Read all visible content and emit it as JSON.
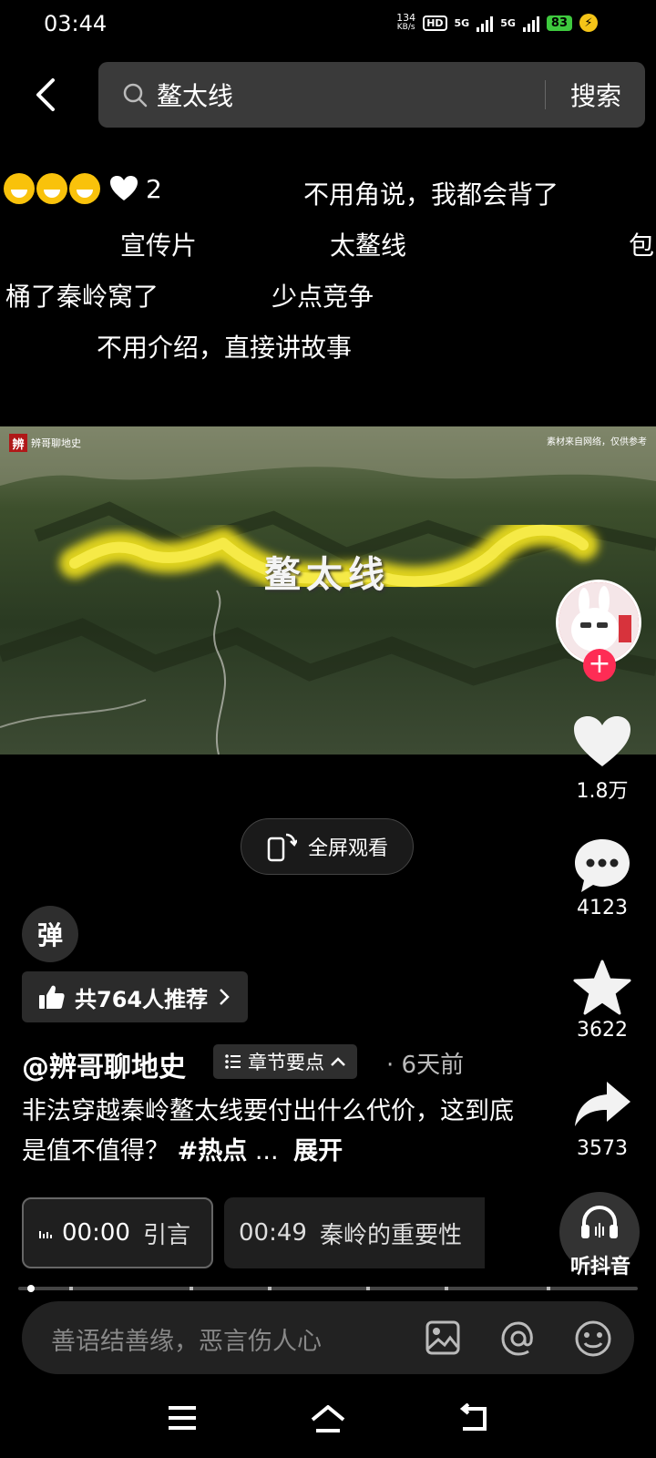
{
  "status_bar": {
    "time": "03:44",
    "net_speed": "134",
    "net_unit": "KB/s",
    "hd": "HD",
    "sim1": "5G",
    "sim2": "5G",
    "battery": "83"
  },
  "search": {
    "query": "鳌太线",
    "button_label": "搜索"
  },
  "danmaku": {
    "likes": "2",
    "lines": [
      "不用角说，我都会背了",
      "宣传片",
      "太鳌线",
      "包",
      "桶了秦岭窝了",
      "少点竞争",
      "不用介绍，直接讲故事"
    ]
  },
  "video": {
    "channel_logo_text": "辨哥聊地史",
    "watermark": "素材来自网络，仅供参考",
    "overlay_title": "鳌太线"
  },
  "actions": {
    "like_count": "1.8万",
    "comment_count": "4123",
    "favorite_count": "3622",
    "share_count": "3573",
    "listen_label": "听抖音"
  },
  "player": {
    "fullscreen_label": "全屏观看",
    "danmaku_toggle": "弹"
  },
  "recommend": {
    "label": "共764人推荐"
  },
  "post": {
    "author": "@辨哥聊地史",
    "chapter_tag": "章节要点",
    "time": "· 6天前",
    "caption_text": "非法穿越秦岭鳌太线要付出什么代价，这到底是值不值得？",
    "hashtag": "#热点",
    "ellipsis": "...",
    "expand_label": "展开"
  },
  "chapters": [
    {
      "time": "00:00",
      "title": "引言"
    },
    {
      "time": "00:49",
      "title": "秦岭的重要性"
    }
  ],
  "comment": {
    "placeholder": "善语结善缘，恶言伤人心"
  },
  "colors": {
    "accent": "#fe2c55",
    "highlight_route": "#f2e21c",
    "background": "#000000"
  }
}
